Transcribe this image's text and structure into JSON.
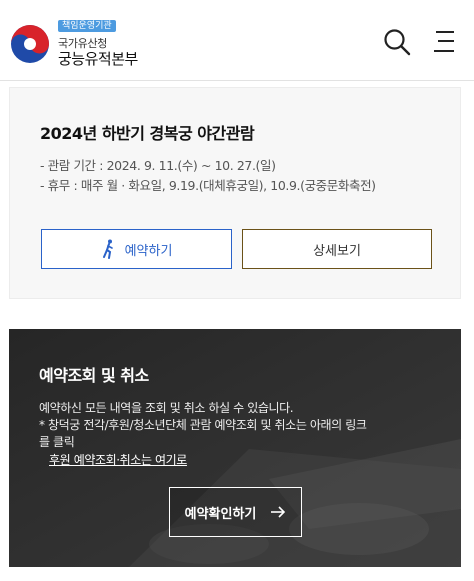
{
  "header": {
    "logo_badge": "책임운영기관",
    "logo_sub": "국가유산청",
    "logo_main": "궁능유적본부",
    "search_icon": "search-icon",
    "menu_icon": "menu-icon"
  },
  "program": {
    "title": "2024년 하반기 경복궁 야간관람",
    "period": "- 관람 기간 : 2024. 9. 11.(수) ~ 10. 27.(일)",
    "closed": "- 휴무 : 매주 월 · 화요일, 9.19.(대체휴궁일), 10.9.(궁중문화축전)",
    "reserve_label": "예약하기",
    "reserve_icon": "walking-person-icon",
    "detail_label": "상세보기"
  },
  "lookup": {
    "title": "예약조회 및 취소",
    "line1": "예약하신 모든 내역을 조회 및 취소 하실 수 있습니다.",
    "line2": "* 창덕궁 전각/후원/청소년단체 관람 예약조회 및 취소는 아래의 링크",
    "line3": "를 클릭",
    "link_label": "후원 예약조회·취소는 여기로",
    "button_label": "예약확인하기",
    "button_icon": "arrow-right-icon"
  },
  "colors": {
    "accent_blue": "#2a62c9",
    "detail_border": "#6b5218",
    "banner_bg": "#2c2c2c",
    "badge_blue": "#4d9be0"
  }
}
